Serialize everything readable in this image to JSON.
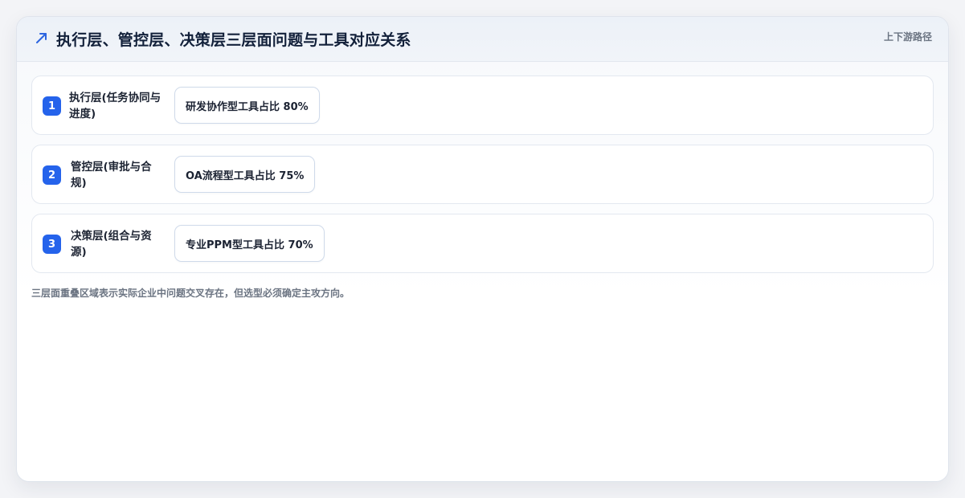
{
  "header": {
    "icon": "trend-arrow-icon",
    "title": "执行层、管控层、决策层三层面问题与工具对应关系",
    "tag": "上下游路径"
  },
  "rows": [
    {
      "num": "1",
      "label": "执行层(任务协同与进度)",
      "tool": "研发协作型工具占比 80%"
    },
    {
      "num": "2",
      "label": "管控层(审批与合规)",
      "tool": "OA流程型工具占比 75%"
    },
    {
      "num": "3",
      "label": "决策层(组合与资源)",
      "tool": "专业PPM型工具占比 70%"
    }
  ],
  "footnote": "三层面重叠区域表示实际企业中问题交叉存在，但选型必须确定主攻方向。",
  "colors": {
    "accent": "#2563eb",
    "title": "#12203a",
    "muted": "#6b7482"
  }
}
